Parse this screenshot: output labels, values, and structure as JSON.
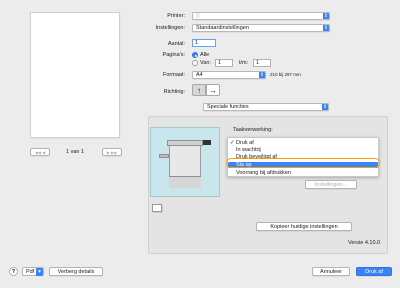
{
  "preview": {
    "page_indicator": "1 van 1",
    "nav_left": "◀◀ ◀",
    "nav_right": "▶ ▶▶"
  },
  "form": {
    "printer_label": "Printer:",
    "presets_label": "Instellingen:",
    "presets_value": "Standaardinstellingen",
    "copies_label": "Aantal:",
    "copies_value": "1",
    "pages_label": "Pagina's:",
    "pages_all": "Alle",
    "pages_from": "Van:",
    "pages_from_value": "1",
    "pages_to": "t/m:",
    "pages_to_value": "1",
    "format_label": "Formaat:",
    "format_value": "A4",
    "format_size": "210 bij 297 mm",
    "orientation_label": "Richting:",
    "section_value": "Speciale functies"
  },
  "panel": {
    "job_processing_label": "Taakverwerking:",
    "settings_button": "Instellingen...",
    "copy_settings_button": "Kopieer huidige instellingen",
    "version": "Versie 4.10.0"
  },
  "menu": {
    "items": [
      {
        "check": "✓",
        "label": "Druk af"
      },
      {
        "check": "",
        "label": "In wachtrij"
      },
      {
        "check": "",
        "label": "Druk beveiligd af"
      },
      {
        "check": "",
        "label": "Sla op"
      },
      {
        "check": "",
        "label": "Voorrang bij afdrukken"
      }
    ],
    "selected_index": 3,
    "accent": "#3b82f6",
    "highlight_ring": "#f59e0b"
  },
  "footer": {
    "help": "?",
    "pdf": "Pdf",
    "hide_details": "Verberg details",
    "cancel": "Annuleer",
    "print": "Druk af"
  },
  "icons": {
    "arrow": "▾",
    "stepper": "⇕",
    "portrait": "↑",
    "landscape": "→"
  }
}
